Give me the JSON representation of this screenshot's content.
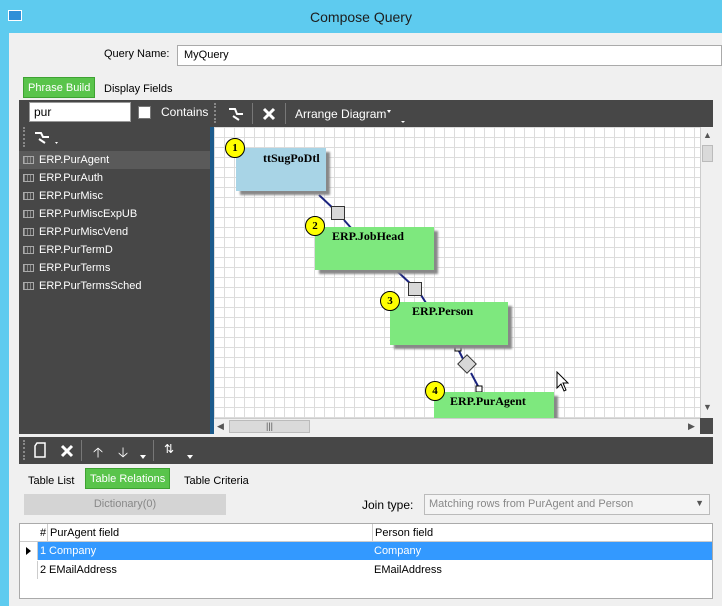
{
  "window": {
    "title": "Compose Query"
  },
  "query": {
    "name_label": "Query Name:",
    "name_value": "MyQuery"
  },
  "top_tabs": [
    {
      "label": "Phrase Build",
      "active": true
    },
    {
      "label": "Display Fields",
      "active": false
    }
  ],
  "search": {
    "value": "pur",
    "contains_label": "Contains",
    "contains_checked": false
  },
  "tables": [
    "ERP.PurAgent",
    "ERP.PurAuth",
    "ERP.PurMisc",
    "ERP.PurMiscExpUB",
    "ERP.PurMiscVend",
    "ERP.PurTermD",
    "ERP.PurTerms",
    "ERP.PurTermsSched"
  ],
  "diagram_toolbar": {
    "arrange_label": "Arrange Diagram"
  },
  "diagram_nodes": [
    {
      "number": "1",
      "name": "ttSugPoDtl",
      "color": "#a8d4e6"
    },
    {
      "number": "2",
      "name": "ERP.JobHead",
      "color": "#7ee87e"
    },
    {
      "number": "3",
      "name": "ERP.Person",
      "color": "#7ee87e"
    },
    {
      "number": "4",
      "name": "ERP.PurAgent",
      "color": "#7ee87e"
    }
  ],
  "bottom_tabs": [
    {
      "label": "Table List",
      "active": false
    },
    {
      "label": "Table Relations",
      "active": true
    },
    {
      "label": "Table Criteria",
      "active": false
    }
  ],
  "relations": {
    "dictionary_button": "Dictionary(0)",
    "join_type_label": "Join type:",
    "join_type_value": "Matching rows from PurAgent and Person",
    "columns": [
      "#",
      "PurAgent field",
      "Person field"
    ],
    "rows": [
      {
        "num": "1",
        "left": "Company",
        "right": "Company",
        "selected": true
      },
      {
        "num": "2",
        "left": "EMailAddress",
        "right": "EMailAddress",
        "selected": false
      }
    ]
  },
  "colors": {
    "accent_green": "#59c44b",
    "titlebar": "#5ecbef",
    "selection": "#3399ff"
  }
}
